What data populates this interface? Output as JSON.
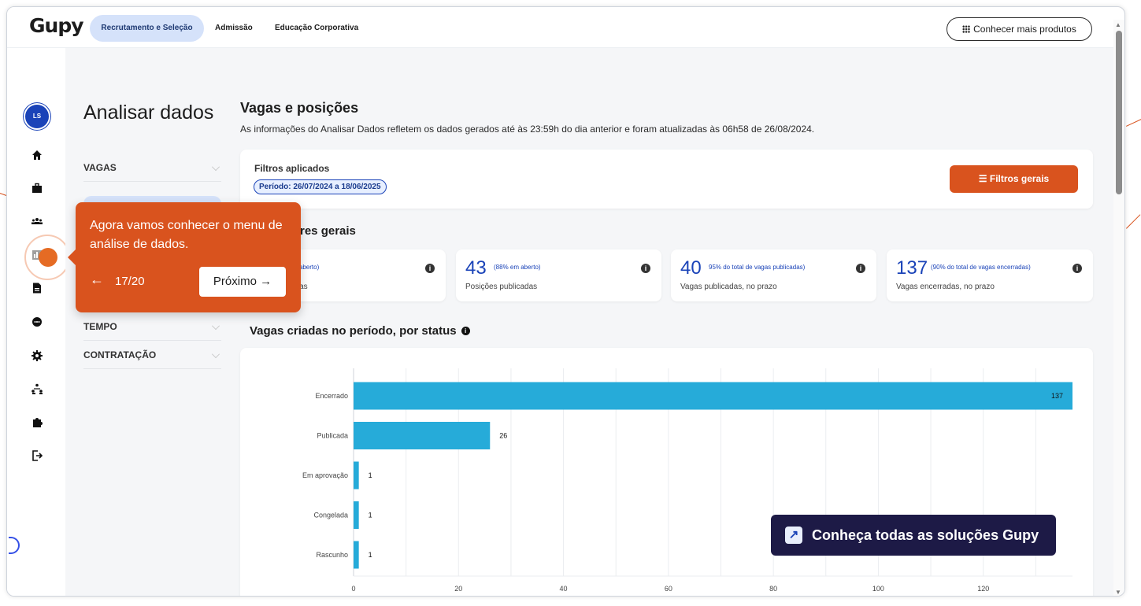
{
  "app": {
    "logo": "Gupy",
    "nav": [
      "Recrutamento e Seleção",
      "Admissão",
      "Educação Corporativa"
    ],
    "products_button": "Conhecer mais produtos"
  },
  "sidebar": {
    "avatar_initials": "LS",
    "icons": [
      "home-icon",
      "briefcase-icon",
      "people-icon",
      "chart-icon",
      "document-icon",
      "chat-icon",
      "gear-icon",
      "org-chart-icon",
      "puzzle-icon",
      "logout-icon"
    ]
  },
  "page": {
    "title": "Analisar dados",
    "submenu": [
      "VAGAS",
      "TEMPO",
      "CONTRATAÇÃO"
    ]
  },
  "main": {
    "heading": "Vagas e posições",
    "info": "As informações do Analisar Dados refletem os dados gerados até às 23:59h do dia anterior e foram atualizadas às 06h58 de 26/08/2024.",
    "filters_title": "Filtros aplicados",
    "period_chip": "Período: 26/07/2024 a 18/06/2025",
    "filters_button": "Filtros gerais",
    "indicators_heading_visible": "res gerais",
    "kpis": [
      {
        "value": "",
        "note": "m aberto)",
        "label": "adas"
      },
      {
        "value": "43",
        "note": "(88% em aberto)",
        "label": "Posições publicadas"
      },
      {
        "value": "40",
        "note": "95% do total de vagas publicadas)",
        "label": "Vagas publicadas, no prazo"
      },
      {
        "value": "137",
        "note": "(90% do total de vagas encerradas)",
        "label": "Vagas encerradas, no prazo"
      }
    ],
    "chart_heading": "Vagas criadas no período, por status"
  },
  "chart_data": {
    "type": "bar",
    "orientation": "horizontal",
    "categories": [
      "Encerrado",
      "Publicada",
      "Em aprovação",
      "Congelada",
      "Rascunho"
    ],
    "values": [
      137,
      26,
      1,
      1,
      1
    ],
    "xticks": [
      0,
      20,
      40,
      60,
      80,
      100,
      120
    ],
    "xlim": [
      0,
      137
    ],
    "grid": true,
    "bar_color": "#26abd9"
  },
  "tour": {
    "text": "Agora vamos conhecer o menu de análise de dados.",
    "step": "17/20",
    "next_label": "Próximo →"
  },
  "cta": {
    "label": "Conheça todas as soluções Gupy"
  },
  "colors": {
    "accent": "#d9531e",
    "primary_blue": "#1a43b8",
    "nav_active_bg": "#d5e2fa"
  }
}
